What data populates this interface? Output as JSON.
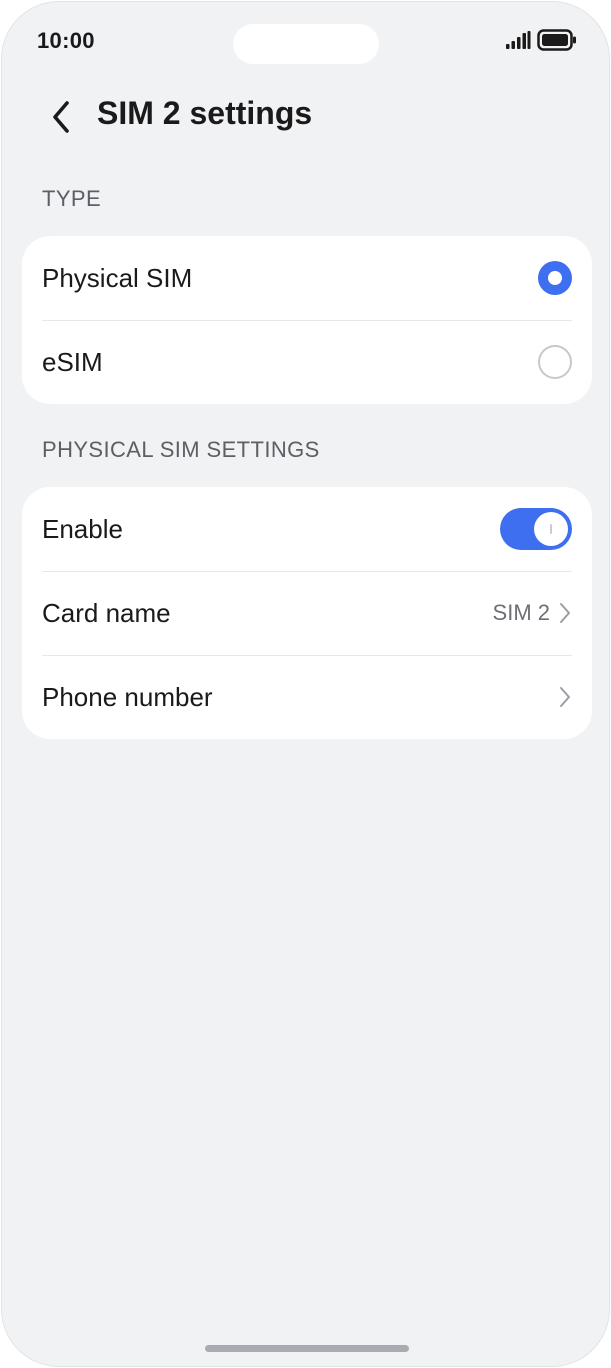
{
  "status_bar": {
    "time": "10:00"
  },
  "header": {
    "title": "SIM 2 settings"
  },
  "type_section": {
    "label": "TYPE",
    "options": [
      {
        "label": "Physical SIM",
        "selected": true
      },
      {
        "label": "eSIM",
        "selected": false
      }
    ]
  },
  "physical_sim_section": {
    "label": "PHYSICAL SIM SETTINGS",
    "enable": {
      "label": "Enable",
      "on": true
    },
    "card_name": {
      "label": "Card name",
      "value": "SIM 2"
    },
    "phone_number": {
      "label": "Phone number"
    }
  },
  "colors": {
    "accent": "#3e6ff0",
    "background": "#f1f2f4",
    "card": "#ffffff"
  },
  "icons": {
    "back": "chevron-left-icon",
    "signal": "signal-icon",
    "battery": "battery-icon",
    "row_arrow": "chevron-right-icon"
  }
}
